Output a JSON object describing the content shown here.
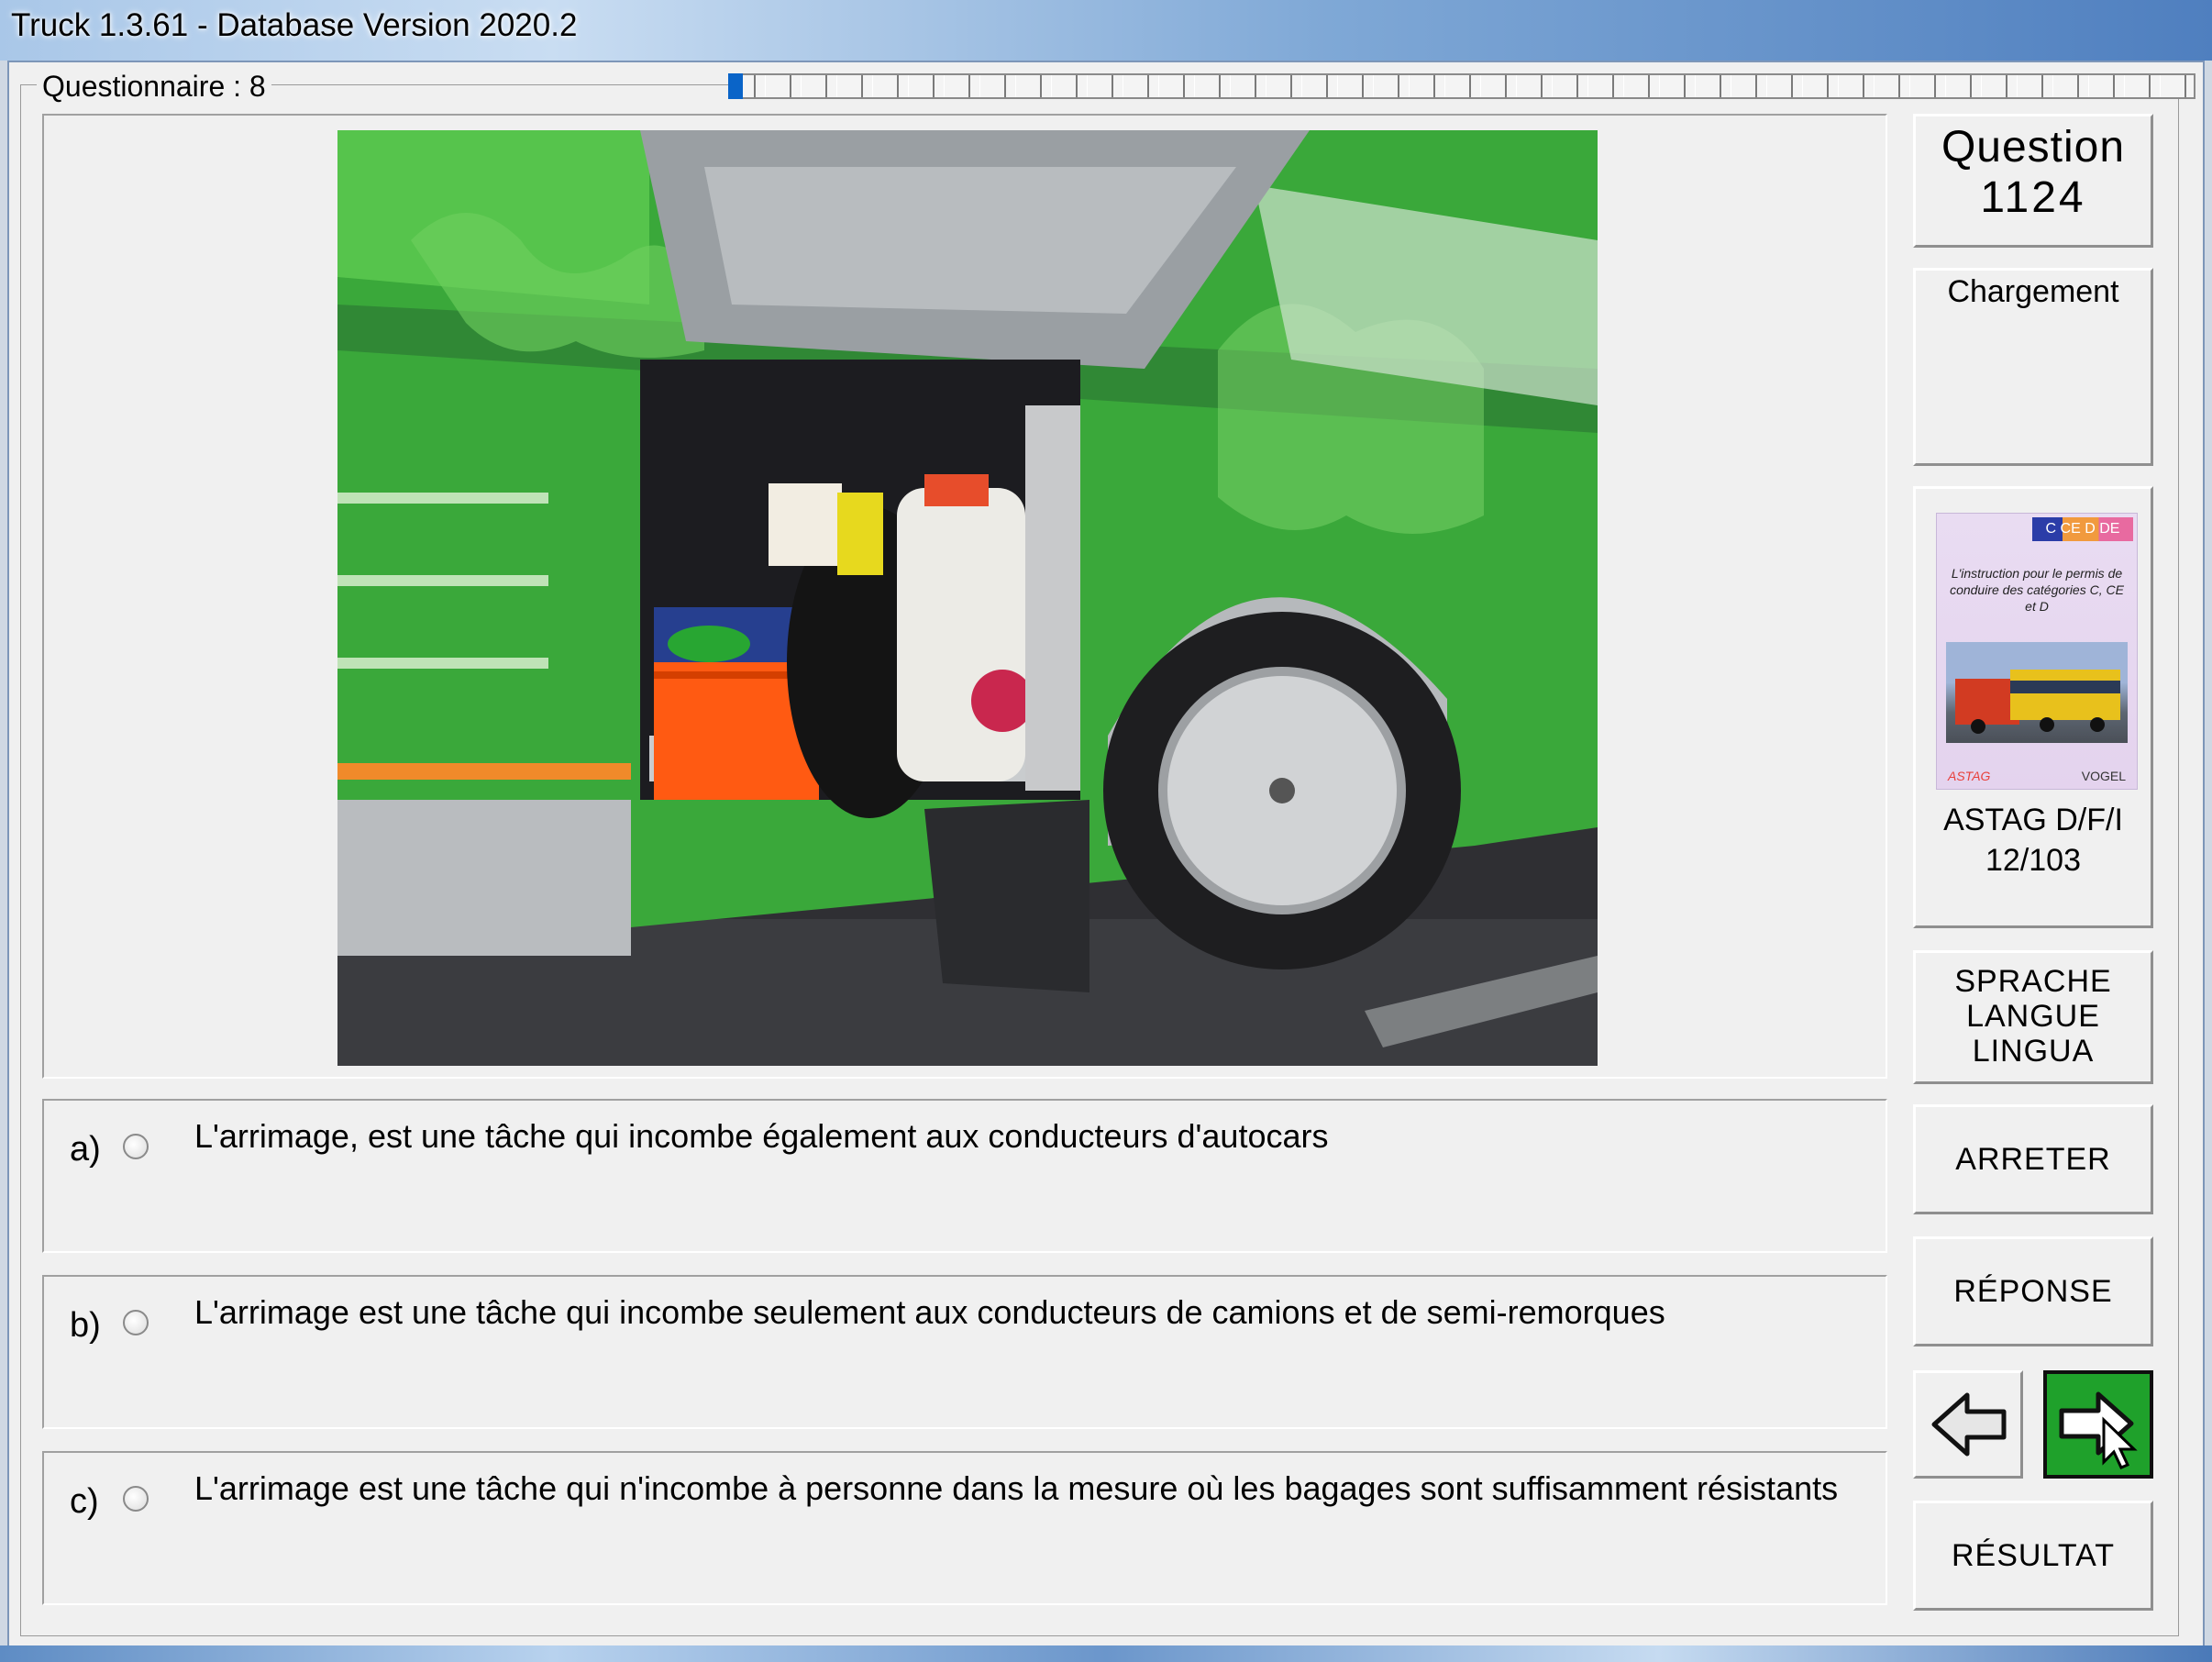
{
  "window": {
    "title": "Truck 1.3.61 - Database Version 2020.2"
  },
  "questionnaire": {
    "label": "Questionnaire : 8",
    "progress": 0.01
  },
  "question": {
    "label": "Question",
    "number": "1124",
    "category": "Chargement"
  },
  "answers": [
    {
      "letter": "a)",
      "text": "L'arrimage, est une tâche qui incombe également aux conducteurs d'autocars",
      "selected": false
    },
    {
      "letter": "b)",
      "text": "L'arrimage est une tâche qui incombe seulement aux conducteurs de camions et de semi-remorques",
      "selected": false
    },
    {
      "letter": "c)",
      "text": "L'arrimage est une tâche qui n'incombe à personne dans la mesure où les bagages sont suffisamment résistants",
      "selected": false
    }
  ],
  "source": {
    "book_badge": "C CE D DE",
    "book_text": "L'instruction pour le permis de conduire des catégories C, CE et D",
    "book_logo_left": "ASTAG",
    "book_logo_right": "VOGEL",
    "name": "ASTAG D/F/I",
    "page": "12/103"
  },
  "buttons": {
    "language_1": "SPRACHE",
    "language_2": "LANGUE",
    "language_3": "LINGUA",
    "stop": "ARRETER",
    "answer": "RÉPONSE",
    "result": "RÉSULTAT"
  },
  "icons": {
    "back": "arrow-left-icon",
    "next": "arrow-right-icon",
    "cursor": "mouse-pointer-icon"
  },
  "colors": {
    "next_button": "#1fa12b",
    "bus_green": "#3aa83a"
  }
}
